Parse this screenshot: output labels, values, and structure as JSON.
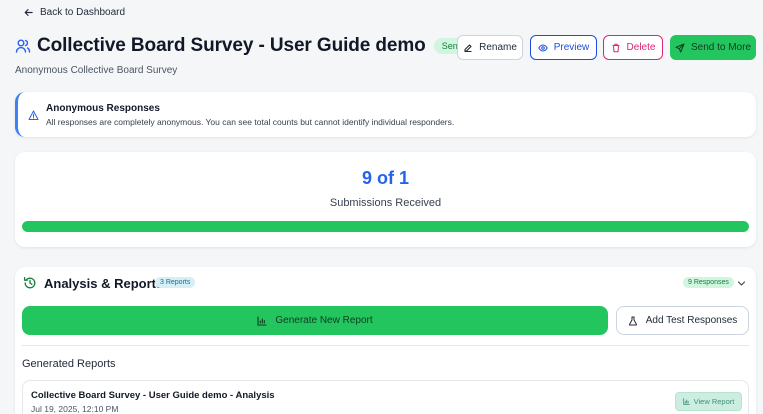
{
  "nav": {
    "back_label": "Back to Dashboard"
  },
  "header": {
    "title": "Collective Board Survey - User Guide demo",
    "status": "Sent",
    "subtitle": "Anonymous Collective Board Survey",
    "actions": {
      "rename": "Rename",
      "preview": "Preview",
      "delete": "Delete",
      "send": "Send to More"
    }
  },
  "notice": {
    "title": "Anonymous Responses",
    "body": "All responses are completely anonymous. You can see total counts but cannot identify individual responders."
  },
  "submissions": {
    "count_text": "9 of 1",
    "label": "Submissions Received",
    "progress_fraction": 1.0
  },
  "analysis": {
    "title": "Analysis & Reports",
    "reports_badge": "3 Reports",
    "responses_badge": "9 Responses",
    "generate_label": "Generate New Report",
    "add_test_label": "Add Test Responses",
    "generated_heading": "Generated Reports",
    "reports": [
      {
        "title": "Collective Board Survey - User Guide demo - Analysis",
        "date": "Jul 19, 2025, 12:10 PM",
        "view_label": "View Report"
      }
    ]
  },
  "colors": {
    "accent_green": "#22c55e",
    "accent_blue": "#2563eb",
    "delete_pink": "#db2777"
  }
}
